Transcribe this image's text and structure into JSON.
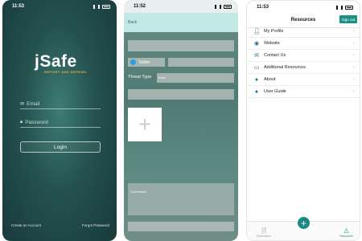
{
  "login_screen": {
    "time": "11:53",
    "logo": "jSafe",
    "tagline": "REPORT AND DEFEND",
    "email_placeholder": "Email",
    "password_placeholder": "Password",
    "login_label": "Login",
    "create_account": "Create an Account",
    "forgot_password": "Forgot Password"
  },
  "report_screen": {
    "time": "11:52",
    "back_label": "Back",
    "twitter_label": "Twitter",
    "threat_type_label": "Threat Type",
    "threat_type_value": "Email",
    "comments_placeholder": "Comments"
  },
  "resources_screen": {
    "time": "11:53",
    "title": "Resources",
    "signout_label": "Sign out",
    "menu": [
      {
        "label": "My Profile",
        "icon": "person-icon"
      },
      {
        "label": "Website",
        "icon": "globe-icon"
      },
      {
        "label": "Contact Us",
        "icon": "envelope-icon"
      },
      {
        "label": "Additional Resources",
        "icon": "monitor-icon"
      },
      {
        "label": "About",
        "icon": "info-icon"
      },
      {
        "label": "User Guide",
        "icon": "question-icon"
      }
    ],
    "tabs": {
      "submission": "Submission",
      "resources": "Resources"
    },
    "accent_color": "#1e8f84"
  }
}
